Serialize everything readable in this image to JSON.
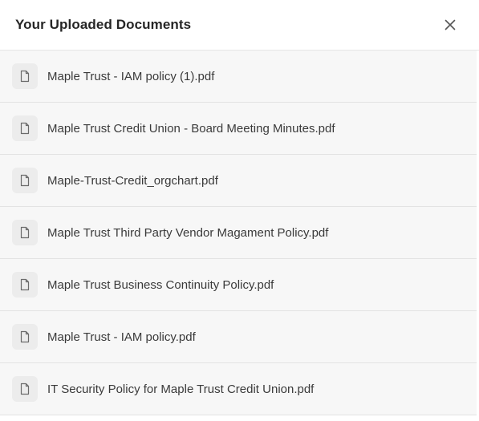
{
  "dialog": {
    "title": "Your Uploaded Documents",
    "close_icon": "close-icon"
  },
  "documents": [
    {
      "name": "Maple Trust - IAM policy (1).pdf",
      "icon": "file-icon"
    },
    {
      "name": "Maple Trust Credit Union - Board Meeting Minutes.pdf",
      "icon": "file-icon"
    },
    {
      "name": "Maple-Trust-Credit_orgchart.pdf",
      "icon": "file-icon"
    },
    {
      "name": "Maple Trust Third Party Vendor Magament Policy.pdf",
      "icon": "file-icon"
    },
    {
      "name": "Maple Trust Business Continuity Policy.pdf",
      "icon": "file-icon"
    },
    {
      "name": "Maple Trust - IAM policy.pdf",
      "icon": "file-icon"
    },
    {
      "name": "IT Security Policy for Maple Trust Credit Union.pdf",
      "icon": "file-icon"
    }
  ],
  "colors": {
    "row_background": "#f7f7f7",
    "icon_background": "#ececec",
    "text": "#3a3a3a",
    "title": "#262626"
  }
}
